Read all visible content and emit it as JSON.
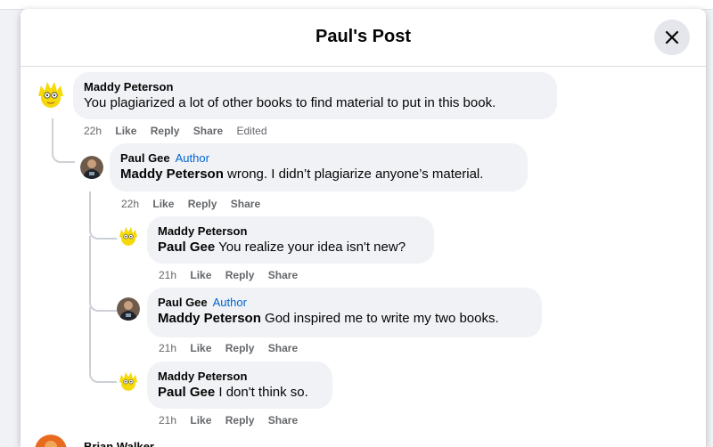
{
  "modal": {
    "title": "Paul's Post",
    "close_label": "×"
  },
  "actions": {
    "like": "Like",
    "reply": "Reply",
    "share": "Share"
  },
  "comments": [
    {
      "author": "Maddy Peterson",
      "badge": "",
      "mention": "",
      "text": "You plagiarized a lot of other books to find material to put in this book.",
      "time": "22h",
      "edited": "Edited"
    },
    {
      "author": "Paul Gee",
      "badge": "Author",
      "mention": "Maddy Peterson",
      "text": " wrong. I didn’t plagiarize anyone’s material.",
      "time": "22h"
    },
    {
      "author": "Maddy Peterson",
      "badge": "",
      "mention": "Paul Gee",
      "text": " You realize your idea isn't new?",
      "time": "21h"
    },
    {
      "author": "Paul Gee",
      "badge": "Author",
      "mention": "Maddy Peterson",
      "text": " God inspired me to write my two books.",
      "time": "21h"
    },
    {
      "author": "Maddy Peterson",
      "badge": "",
      "mention": "Paul Gee",
      "text": " I don't think so.",
      "time": "21h"
    },
    {
      "author": "Brian Walker"
    }
  ],
  "colors": {
    "bubble": "#f0f2f5",
    "author_badge": "#0064d1",
    "meta_text": "#65676b"
  }
}
